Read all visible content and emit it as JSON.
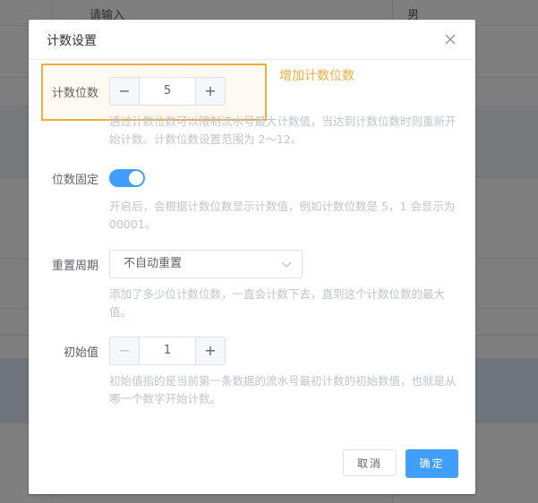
{
  "background": {
    "placeholder_cell": "请输入",
    "gender_cell": "男"
  },
  "dialog": {
    "title": "计数设置",
    "close_icon": "close-icon"
  },
  "annotation": {
    "note": "增加计数位数"
  },
  "count_digits": {
    "label": "计数位数",
    "value": "5",
    "minus": "−",
    "plus": "+",
    "description": "通过计数位数可以限制流水号最大计数值，当达到计数位数时则重新开始计数。计数位数设置范围为 2～12。"
  },
  "fixed_digits": {
    "label": "位数固定",
    "enabled": true,
    "description": "开启后，会根据计数位数显示计数值，例如计数位数是 5，1 会显示为 00001。"
  },
  "reset_period": {
    "label": "重置周期",
    "selected": "不自动重置",
    "description": "添加了多少位计数位数，一直会计数下去，直到这个计数位数的最大值。"
  },
  "initial_value": {
    "label": "初始值",
    "value": "1",
    "minus": "−",
    "plus": "+",
    "description": "初始值指的是当前第一条数据的流水号最初计数的初始数值，也就是从哪一个数字开始计数。"
  },
  "footer": {
    "cancel": "取消",
    "confirm": "确定"
  },
  "colors": {
    "primary": "#409eff",
    "highlight": "#f0ad3c"
  }
}
